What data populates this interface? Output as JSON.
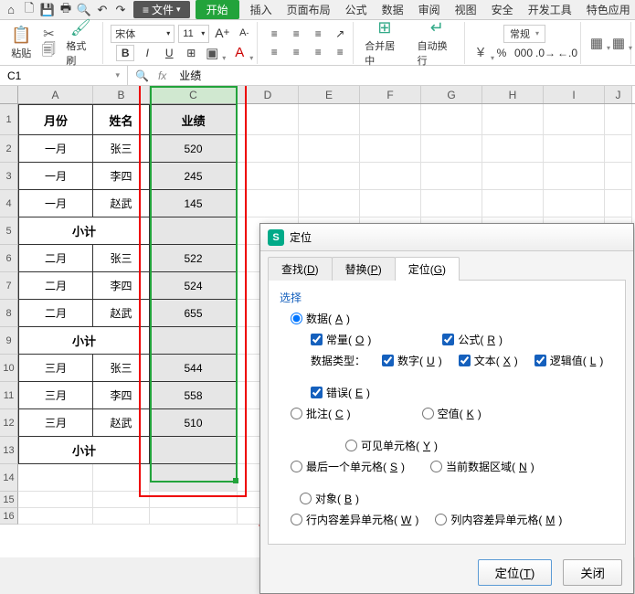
{
  "menubar": {
    "file_label": "文件",
    "start_label": "开始",
    "tabs": [
      "插入",
      "页面布局",
      "公式",
      "数据",
      "审阅",
      "视图",
      "安全",
      "开发工具",
      "特色应用"
    ]
  },
  "ribbon": {
    "paste": "粘贴",
    "format_brush": "格式刷",
    "font_name": "宋体",
    "font_size": "11",
    "merge_center": "合并居中",
    "auto_wrap": "自动换行",
    "normal": "常规",
    "bold": "B",
    "italic": "I",
    "underline": "U",
    "increase_font": "A",
    "decrease_font": "A"
  },
  "formula_bar": {
    "name_box": "C1",
    "fx_value": "业绩"
  },
  "columns": [
    "A",
    "B",
    "C",
    "D",
    "E",
    "F",
    "G",
    "H",
    "I",
    "J"
  ],
  "table": {
    "headers": {
      "month": "月份",
      "name": "姓名",
      "score": "业绩"
    },
    "rows": [
      {
        "month": "一月",
        "name": "张三",
        "score": "520"
      },
      {
        "month": "一月",
        "name": "李四",
        "score": "245"
      },
      {
        "month": "一月",
        "name": "赵武",
        "score": "145"
      },
      {
        "subtotal": "小计"
      },
      {
        "month": "二月",
        "name": "张三",
        "score": "522"
      },
      {
        "month": "二月",
        "name": "李四",
        "score": "524"
      },
      {
        "month": "二月",
        "name": "赵武",
        "score": "655"
      },
      {
        "subtotal": "小计"
      },
      {
        "month": "三月",
        "name": "张三",
        "score": "544"
      },
      {
        "month": "三月",
        "name": "李四",
        "score": "558"
      },
      {
        "month": "三月",
        "name": "赵武",
        "score": "510"
      },
      {
        "subtotal": "小计"
      }
    ]
  },
  "dialog": {
    "title": "定位",
    "tabs": {
      "find": "查找(D)",
      "replace": "替换(P)",
      "goto": "定位(G)"
    },
    "section": "选择",
    "data": "数据(A)",
    "constant": "常量(O)",
    "formula": "公式(R)",
    "data_type": "数据类型：",
    "number": "数字(U)",
    "text": "文本(X)",
    "logic": "逻辑值(L)",
    "error": "错误(E)",
    "comment": "批注(C)",
    "blank": "空值(K)",
    "visible": "可见单元格(Y)",
    "last_cell": "最后一个单元格(S)",
    "current_region": "当前数据区域(N)",
    "object": "对象(B)",
    "row_diff": "行内容差异单元格(W)",
    "col_diff": "列内容差异单元格(M)",
    "btn_goto": "定位(T)",
    "btn_close": "关闭"
  }
}
